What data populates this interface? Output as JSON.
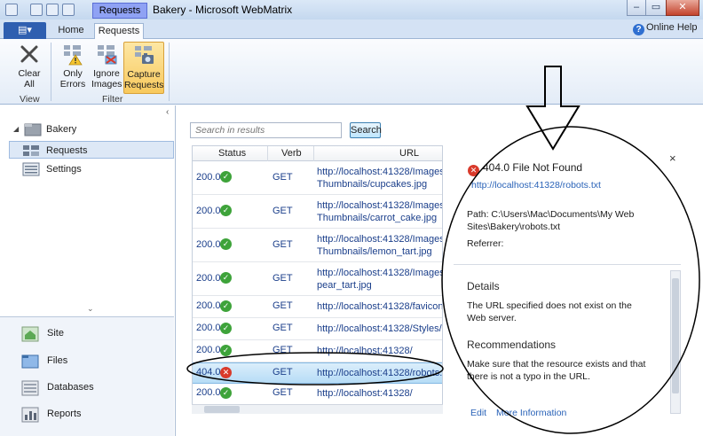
{
  "window": {
    "title": "Bakery - Microsoft WebMatrix",
    "context_tab": "Requests",
    "minimize": "–",
    "restore": "▭",
    "close": "✕"
  },
  "tabs": {
    "file": "▤▾",
    "home": "Home",
    "requests": "Requests",
    "help": "Online Help"
  },
  "ribbon": {
    "clear_all": "Clear All",
    "only_errors": "Only Errors",
    "ignore_images": "Ignore Images",
    "capture_requests": "Capture Requests",
    "group_view": "View",
    "group_filter": "Filter"
  },
  "tree": {
    "site": "Bakery",
    "items": [
      {
        "label": "Requests",
        "selected": true
      },
      {
        "label": "Settings",
        "selected": false
      }
    ]
  },
  "nav": {
    "items": [
      {
        "label": "Site"
      },
      {
        "label": "Files"
      },
      {
        "label": "Databases"
      },
      {
        "label": "Reports"
      }
    ]
  },
  "search": {
    "placeholder": "Search in results",
    "button": "Search"
  },
  "grid": {
    "columns": [
      "Status",
      "Verb",
      "URL"
    ],
    "rows": [
      {
        "status": "200.0",
        "ok": true,
        "verb": "GET",
        "url1": "http://localhost:41328/Images/",
        "url2": "Thumbnails/cupcakes.jpg"
      },
      {
        "status": "200.0",
        "ok": true,
        "verb": "GET",
        "url1": "http://localhost:41328/Images/",
        "url2": "Thumbnails/carrot_cake.jpg"
      },
      {
        "status": "200.0",
        "ok": true,
        "verb": "GET",
        "url1": "http://localhost:41328/Images/",
        "url2": "Thumbnails/lemon_tart.jpg"
      },
      {
        "status": "200.0",
        "ok": true,
        "verb": "GET",
        "url1": "http://localhost:41328/Images/",
        "url2": "pear_tart.jpg"
      },
      {
        "status": "200.0",
        "ok": true,
        "verb": "GET",
        "url1": "http://localhost:41328/favicon.i",
        "url2": ""
      },
      {
        "status": "200.0",
        "ok": true,
        "verb": "GET",
        "url1": "http://localhost:41328/Styles/Si",
        "url2": ""
      },
      {
        "status": "200.0",
        "ok": true,
        "verb": "GET",
        "url1": "http://localhost:41328/",
        "url2": ""
      },
      {
        "status": "404.0",
        "ok": false,
        "verb": "GET",
        "url1": "http://localhost:41328/robots.t",
        "url2": "",
        "selected": true
      },
      {
        "status": "200.0",
        "ok": true,
        "verb": "GET",
        "url1": "http://localhost:41328/",
        "url2": ""
      }
    ]
  },
  "details": {
    "close": "×",
    "title": "404.0 File Not Found",
    "url": "http://localhost:41328/robots.txt",
    "path": "Path: C:\\Users\\Mac\\Documents\\My Web Sites\\Bakery\\robots.txt",
    "referrer": "Referrer:",
    "details_heading": "Details",
    "details_text": "The URL specified does not exist on the Web server.",
    "recommendations_heading": "Recommendations",
    "recommendations_text": "Make sure that the resource exists and that there is not a typo in the URL.",
    "link_edit": "Edit",
    "link_more": "More Information"
  },
  "colors": {
    "accent": "#2f5fb0",
    "context_tab": "#8fa2f4",
    "pressed": "#f8c95d",
    "ok": "#3ea33a",
    "error": "#d93a2b",
    "link": "#2a63b8"
  }
}
